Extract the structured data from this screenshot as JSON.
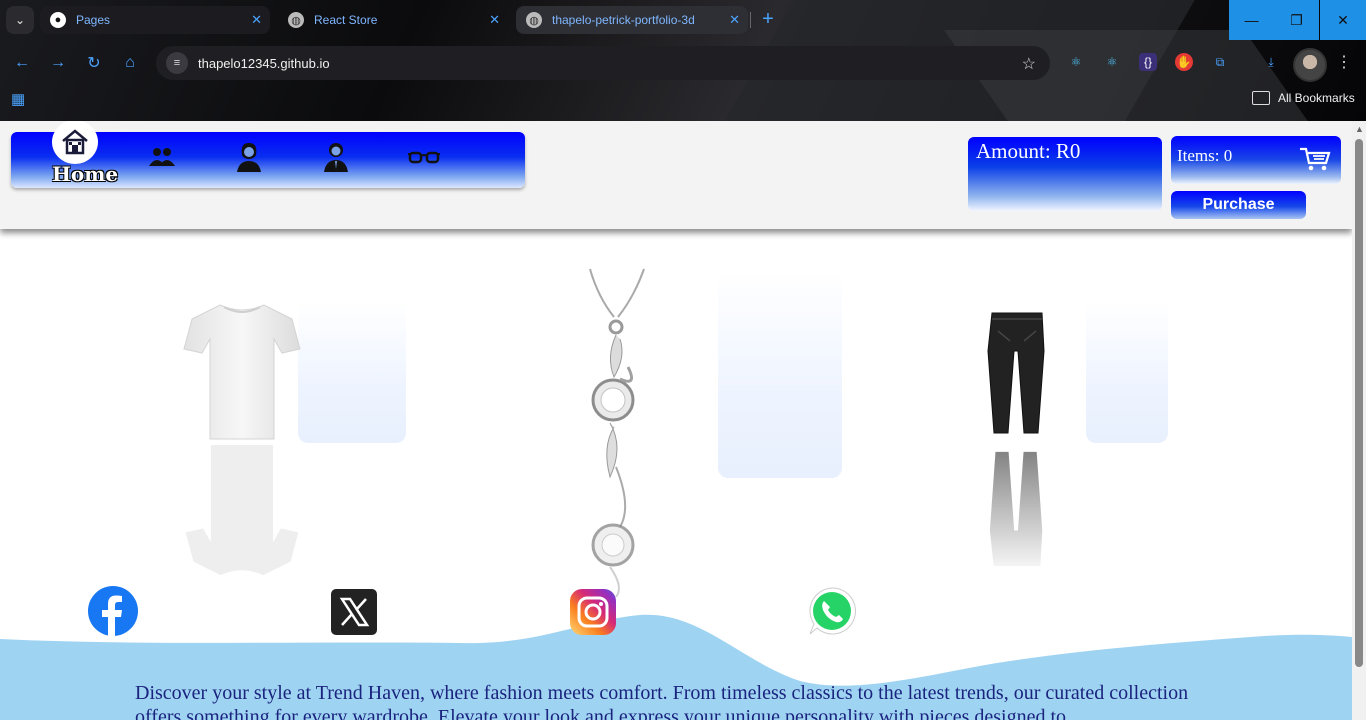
{
  "browser": {
    "tabs": [
      {
        "title": "Pages",
        "icon": "github-icon"
      },
      {
        "title": "React Store",
        "icon": "globe-icon"
      },
      {
        "title": "thapelo-petrick-portfolio-3d",
        "icon": "globe-icon"
      }
    ],
    "url": "thapelo12345.github.io",
    "bookmarks_label": "All Bookmarks"
  },
  "navbar": {
    "home_label": "Home",
    "icons": [
      "home-icon",
      "group-icon",
      "woman-icon",
      "man-icon",
      "glasses-icon"
    ]
  },
  "cart": {
    "amount_label": "Amount: R0",
    "items_label": "Items: 0",
    "purchase_label": "Purchase"
  },
  "products": [
    {
      "name": "white-tshirt"
    },
    {
      "name": "silver-necklace"
    },
    {
      "name": "black-jeans"
    }
  ],
  "socials": [
    "facebook-icon",
    "x-icon",
    "instagram-icon",
    "whatsapp-icon"
  ],
  "footer": {
    "description": "Discover your style at Trend Haven, where fashion meets comfort. From timeless classics to the latest trends, our curated collection offers something for every wardrobe. Elevate your look and express your unique personality with pieces designed to"
  },
  "colors": {
    "accent_blue": "#0000ff",
    "wave": "#9fd3f2",
    "footer_text": "#1a237e"
  }
}
